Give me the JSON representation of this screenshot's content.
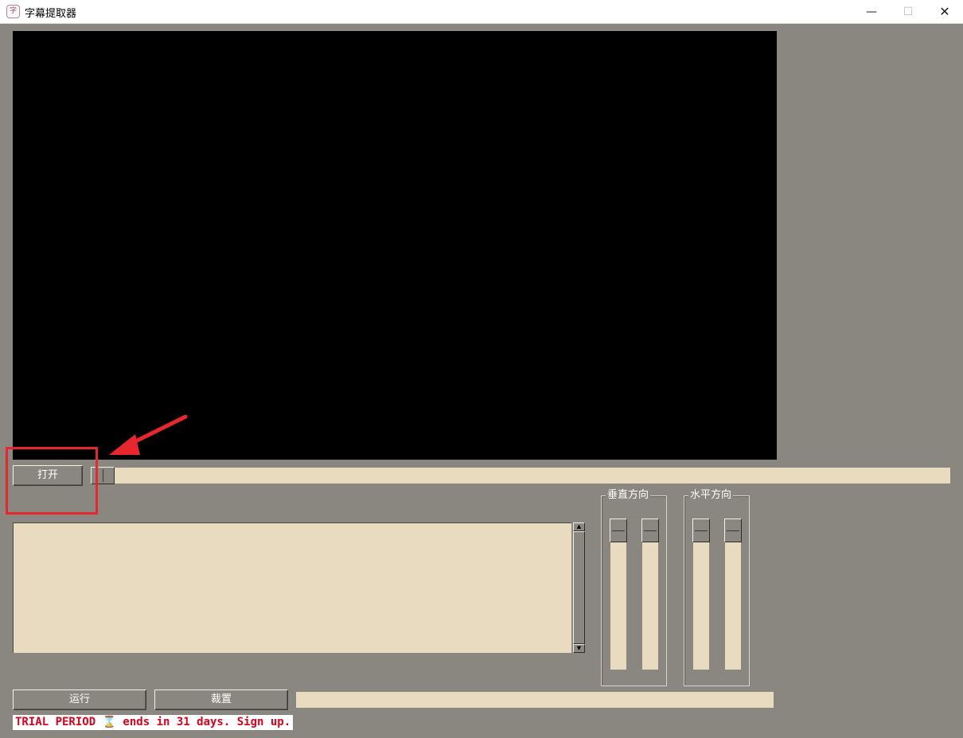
{
  "window": {
    "title": "字幕提取器",
    "icon": "subtitle-app-icon",
    "icon_glyph": "字",
    "controls": {
      "minimize": "—",
      "maximize": "☐",
      "close": "✕"
    }
  },
  "toolbar": {
    "open_label": "打开"
  },
  "groups": {
    "vertical_label": "垂直方向",
    "horizontal_label": "水平方向"
  },
  "actions": {
    "run_label": "运行",
    "reset_label": "裁置"
  },
  "output_text": "",
  "status_text": "",
  "trial_notice": "TRIAL PERIOD ⌛ ends in 31 days. Sign up.",
  "colors": {
    "panel": "#8a8780",
    "track": "#e8dbc0",
    "video": "#000000",
    "annotation": "#e8262d",
    "trial_text": "#e0001b"
  }
}
